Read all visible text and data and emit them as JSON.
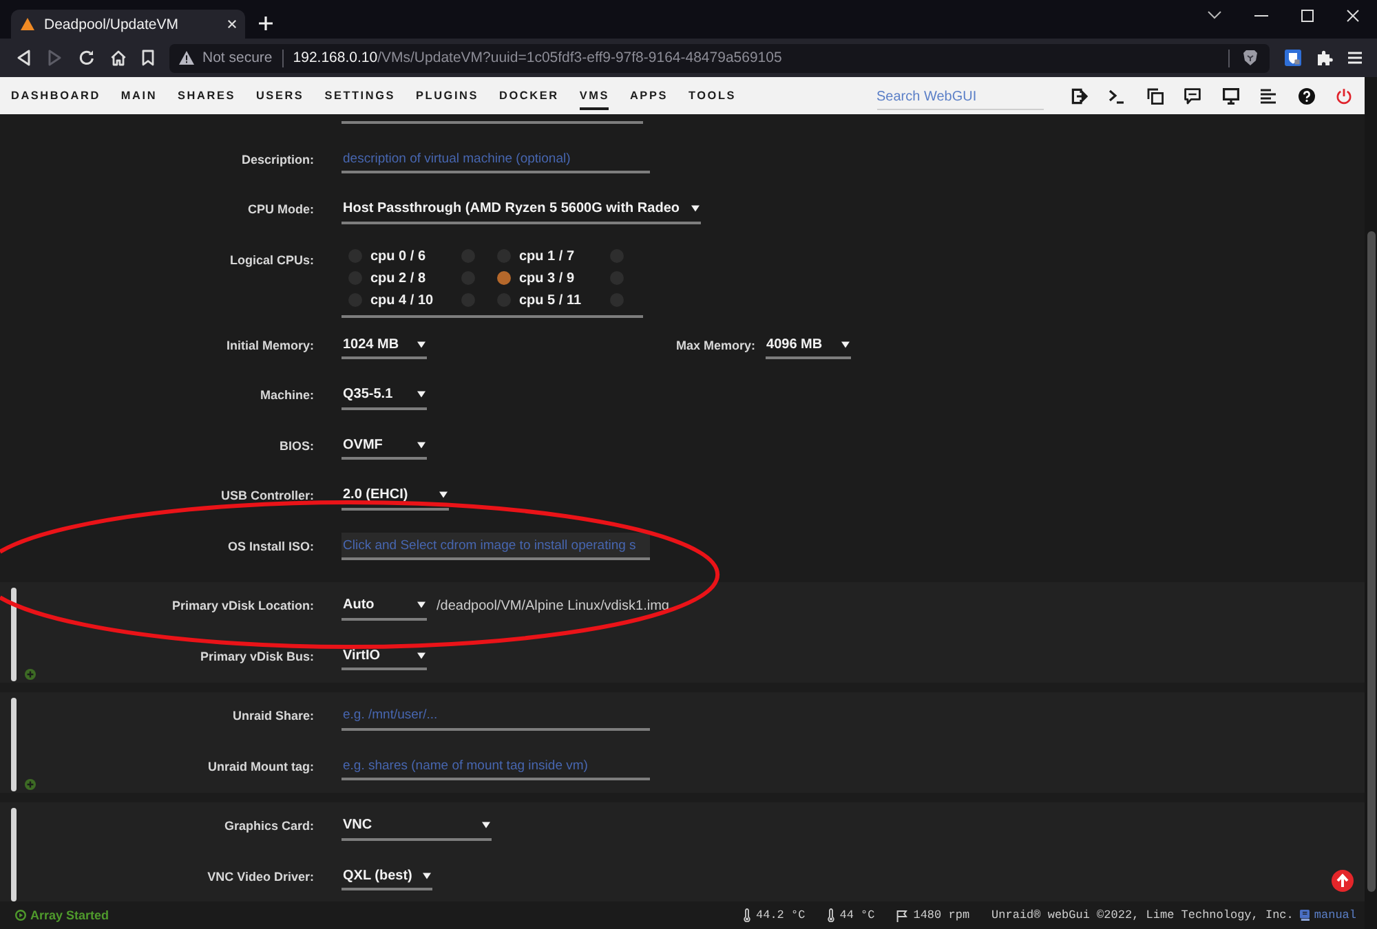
{
  "browser": {
    "tab": {
      "title": "Deadpool/UpdateVM"
    },
    "address": {
      "security": "Not secure",
      "host": "192.168.0.10",
      "path": "/VMs/UpdateVM?uuid=1c05fdf3-eff9-97f8-9164-48479a569105"
    }
  },
  "nav": {
    "items": [
      {
        "label": "DASHBOARD",
        "selected": false
      },
      {
        "label": "MAIN",
        "selected": false
      },
      {
        "label": "SHARES",
        "selected": false
      },
      {
        "label": "USERS",
        "selected": false
      },
      {
        "label": "SETTINGS",
        "selected": false
      },
      {
        "label": "PLUGINS",
        "selected": false
      },
      {
        "label": "DOCKER",
        "selected": false
      },
      {
        "label": "VMS",
        "selected": true
      },
      {
        "label": "APPS",
        "selected": false
      },
      {
        "label": "TOOLS",
        "selected": false
      }
    ],
    "search": {
      "placeholder": "Search WebGUI"
    }
  },
  "form": {
    "rows": [
      {
        "kind": "input",
        "label": "Description:",
        "placeholder": "description of virtual machine (optional)"
      },
      {
        "kind": "select",
        "label": "CPU Mode:",
        "value": "Host Passthrough (AMD Ryzen 5 5600G with Radeo"
      },
      {
        "kind": "cpus",
        "label": "Logical CPUs:",
        "cpus": [
          {
            "label": "cpu 0 / 6",
            "checked": false,
            "trailing_checked": false
          },
          {
            "label": "cpu 1 / 7",
            "checked": false,
            "trailing_checked": false
          },
          {
            "label": "cpu 2 / 8",
            "checked": false,
            "trailing_checked": false
          },
          {
            "label": "cpu 3 / 9",
            "checked": true,
            "trailing_checked": false
          },
          {
            "label": "cpu 4 / 10",
            "checked": false,
            "trailing_checked": false
          },
          {
            "label": "cpu 5 / 11",
            "checked": false,
            "trailing_checked": false
          }
        ]
      },
      {
        "kind": "select",
        "label": "Initial Memory:",
        "value": "1024 MB",
        "paired": {
          "label": "Max Memory:",
          "value": "4096 MB"
        }
      },
      {
        "kind": "select",
        "label": "Machine:",
        "value": "Q35-5.1"
      },
      {
        "kind": "select",
        "label": "BIOS:",
        "value": "OVMF"
      },
      {
        "kind": "select",
        "label": "USB Controller:",
        "value": "2.0 (EHCI)"
      },
      {
        "kind": "file",
        "label": "OS Install ISO:",
        "placeholder": "Click and Select cdrom image to install operating s"
      }
    ]
  },
  "sections": [
    {
      "addable": true,
      "rows": [
        {
          "kind": "select",
          "label": "Primary vDisk Location:",
          "value": "Auto",
          "note": "/deadpool/VM/Alpine Linux/vdisk1.img"
        },
        {
          "kind": "select",
          "label": "Primary vDisk Bus:",
          "value": "VirtIO"
        }
      ]
    },
    {
      "addable": true,
      "rows": [
        {
          "kind": "input",
          "label": "Unraid Share:",
          "placeholder": "e.g. /mnt/user/..."
        },
        {
          "kind": "input",
          "label": "Unraid Mount tag:",
          "placeholder": "e.g. shares (name of mount tag inside vm)"
        }
      ]
    },
    {
      "rows": [
        {
          "kind": "select",
          "label": "Graphics Card:",
          "value": "VNC"
        },
        {
          "kind": "select",
          "label": "VNC Video Driver:",
          "value": "QXL (best)"
        }
      ]
    }
  ],
  "status_bar": {
    "array_status": "Array Started",
    "readings": [
      {
        "kind": "temp",
        "text": "44.2 °C"
      },
      {
        "kind": "temp",
        "text": "44 °C"
      },
      {
        "kind": "fan",
        "text": "1480 rpm"
      }
    ],
    "copyright": "Unraid® webGui ©2022, Lime Technology, Inc.",
    "manual": "manual"
  },
  "annotation": {
    "kind": "ellipse"
  }
}
